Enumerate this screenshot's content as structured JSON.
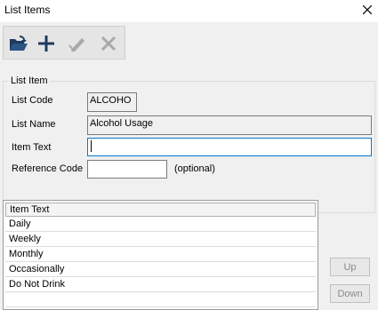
{
  "window": {
    "title": "List Items",
    "close_icon": "close-icon"
  },
  "toolbar": {
    "buttons": [
      {
        "icon": "open-folder-icon",
        "enabled": true
      },
      {
        "icon": "plus-icon",
        "enabled": true
      },
      {
        "icon": "pencil-icon",
        "enabled": false
      },
      {
        "icon": "delete-x-icon",
        "enabled": false
      }
    ]
  },
  "list_item_group": {
    "legend": "List Item",
    "list_code_label": "List Code",
    "list_code_value": "ALCOHO",
    "list_name_label": "List Name",
    "list_name_value": "Alcohol Usage",
    "item_text_label": "Item Text",
    "item_text_value": "",
    "reference_code_label": "Reference Code",
    "reference_code_value": "",
    "optional_note": "(optional)"
  },
  "items_list": {
    "column_header": "Item Text",
    "rows": [
      "Daily",
      "Weekly",
      "Monthly",
      "Occasionally",
      "Do Not Drink"
    ]
  },
  "buttons": {
    "up": "Up",
    "down": "Down"
  },
  "colors": {
    "focus_border": "#0078d7",
    "toolbar_icon": "#1f3a5f"
  }
}
